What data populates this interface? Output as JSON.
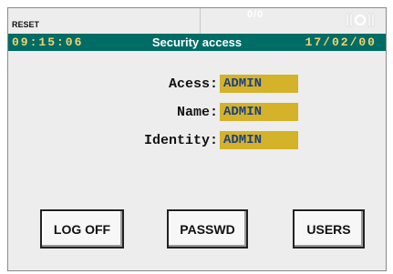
{
  "topbar": {
    "reset_label": "RESET",
    "counter_text": "0/0",
    "signal_icon": "signal-strength-icon"
  },
  "titlebar": {
    "time": "09:15:06",
    "title": "Security access",
    "date": "17/02/00"
  },
  "fields": [
    {
      "label": "Acess:",
      "value": "ADMIN"
    },
    {
      "label": "Name:",
      "value": "ADMIN"
    },
    {
      "label": "Identity:",
      "value": "ADMIN"
    }
  ],
  "buttons": {
    "log_off": "LOG OFF",
    "passwd": "PASSWD",
    "users": "USERS"
  },
  "colors": {
    "titlebar_bg": "#006c66",
    "value_bg": "#d4b229",
    "value_text": "#1a3f88",
    "time_text": "#f3d36b"
  }
}
